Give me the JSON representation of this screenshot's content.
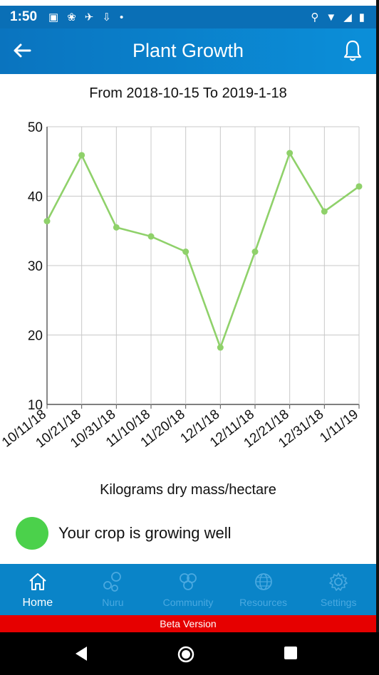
{
  "status_bar": {
    "time": "1:50"
  },
  "app_bar": {
    "title": "Plant Growth"
  },
  "chart_title": "From 2018-10-15 To 2019-1-18",
  "chart_data": {
    "type": "line",
    "categories": [
      "10/11/18",
      "10/21/18",
      "10/31/18",
      "11/10/18",
      "11/20/18",
      "12/1/18",
      "12/11/18",
      "12/21/18",
      "12/31/18",
      "1/11/19"
    ],
    "values": [
      36.4,
      45.9,
      35.5,
      34.2,
      32.0,
      18.2,
      32.0,
      46.2,
      37.8,
      41.4
    ],
    "ylim": [
      10,
      50
    ],
    "yticks": [
      "10",
      "20",
      "30",
      "40",
      "50"
    ],
    "grid": true,
    "color": "#8fd16a"
  },
  "axis_caption": "Kilograms dry mass/hectare",
  "status_message": "Your crop is growing well",
  "status_color": "#4bd14b",
  "nav": {
    "home": "Home",
    "nuru": "Nuru",
    "community": "Community",
    "resources": "Resources",
    "settings": "Settings"
  },
  "beta_label": "Beta Version"
}
